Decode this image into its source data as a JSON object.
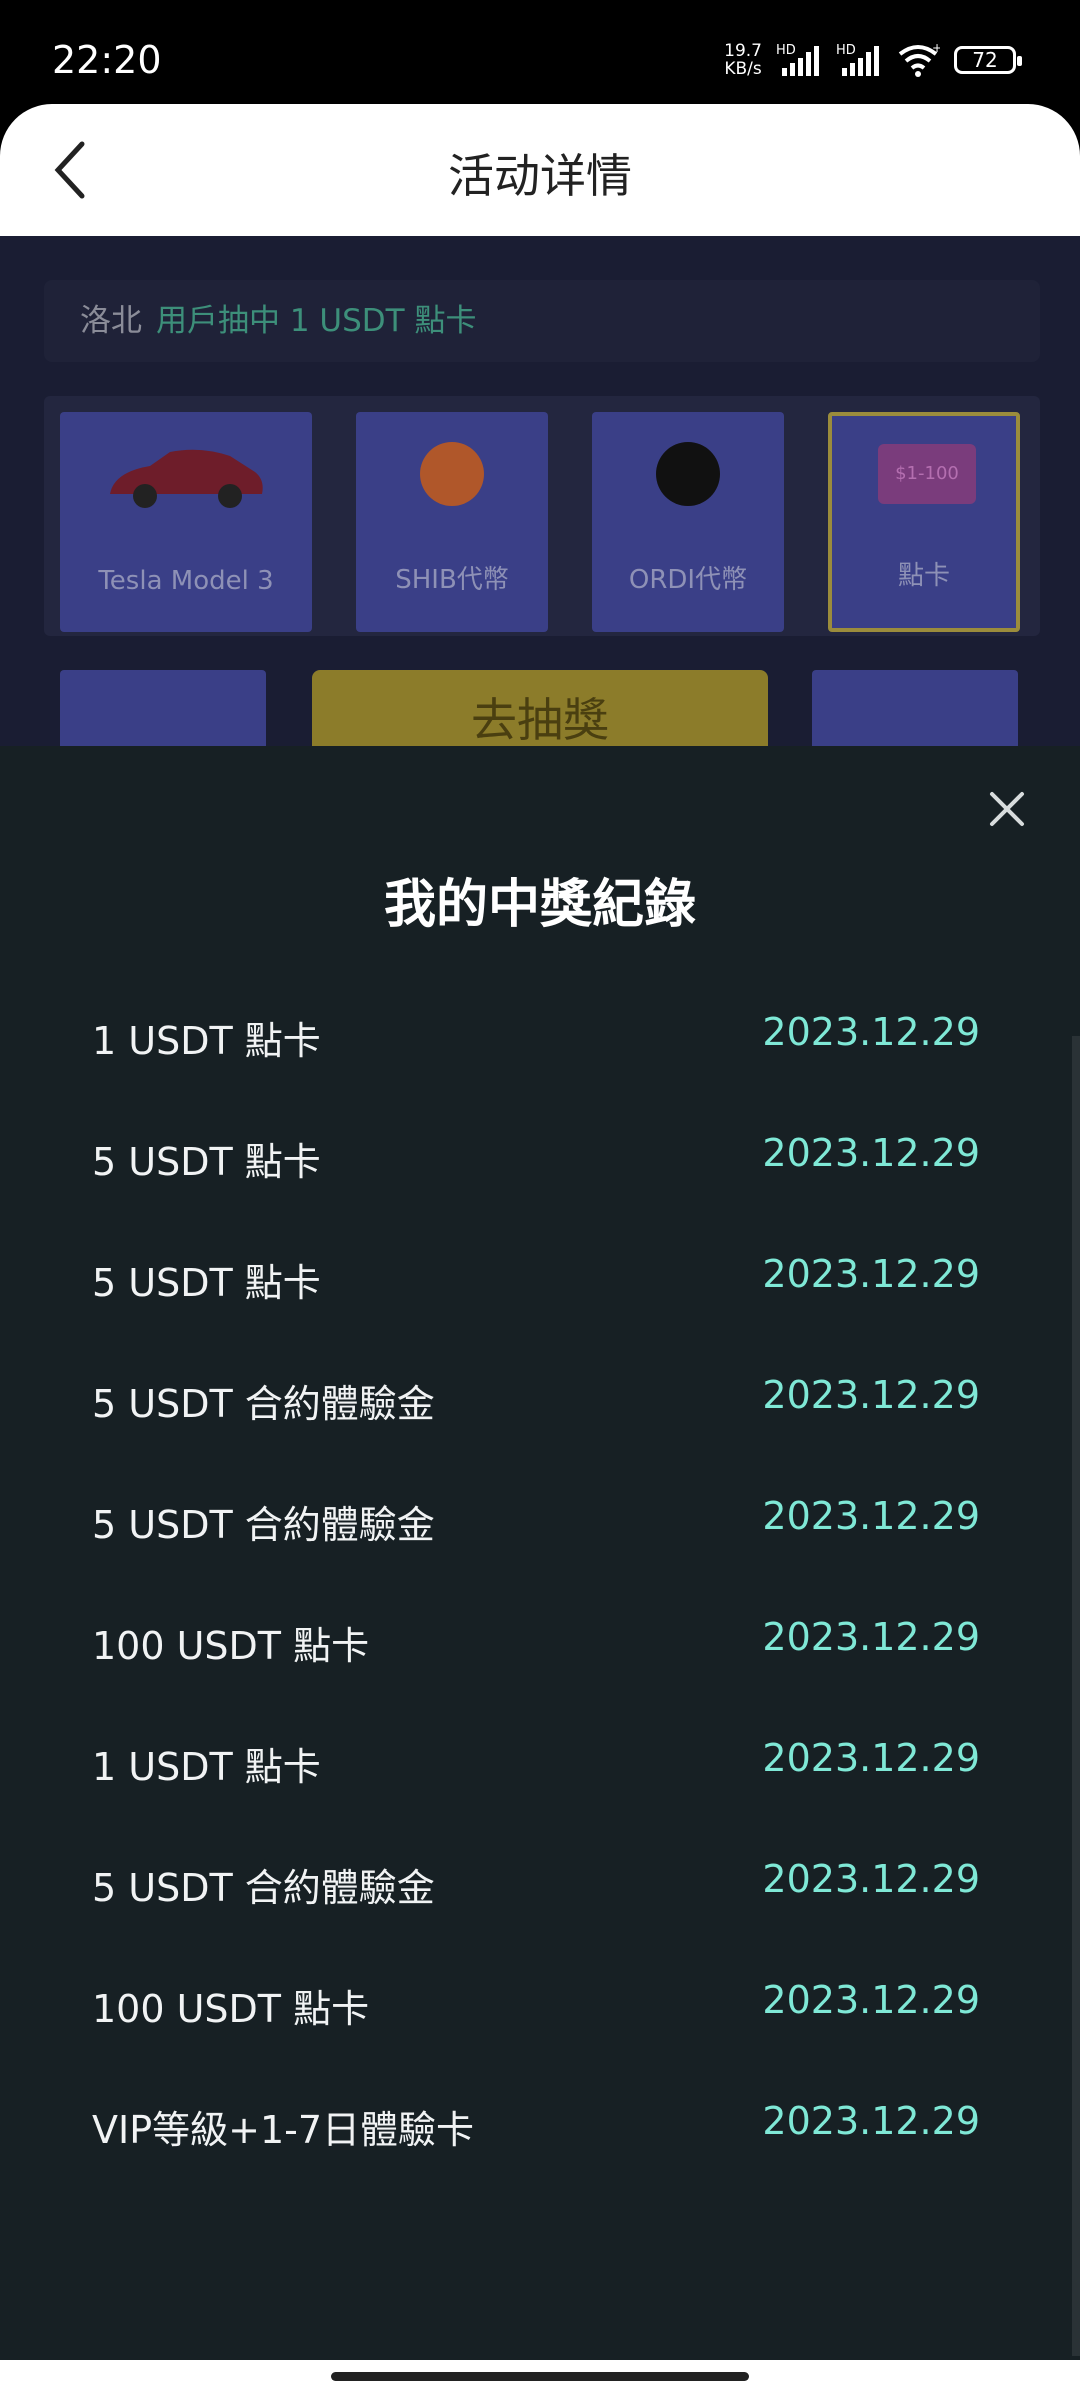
{
  "status_bar": {
    "time": "22:20",
    "net_speed_value": "19.7",
    "net_speed_unit": "KB/s",
    "hd1": "HD",
    "hd2": "HD",
    "battery": "72"
  },
  "header": {
    "title": "活动详情"
  },
  "background_page": {
    "ticker_user": "洛北",
    "ticker_message": "用戶抽中 1 USDT 點卡",
    "prizes": [
      {
        "label": "Tesla Model 3"
      },
      {
        "label": "SHIB代幣"
      },
      {
        "label": "ORDI代幣"
      },
      {
        "label": "點卡",
        "badge": "$1-100"
      }
    ],
    "draw_button": "去抽獎"
  },
  "sheet": {
    "title": "我的中獎紀錄",
    "records": [
      {
        "name": "1 USDT 點卡",
        "date": "2023.12.29"
      },
      {
        "name": "5 USDT 點卡",
        "date": "2023.12.29"
      },
      {
        "name": "5 USDT 點卡",
        "date": "2023.12.29"
      },
      {
        "name": "5 USDT 合約體驗金",
        "date": "2023.12.29"
      },
      {
        "name": "5 USDT 合約體驗金",
        "date": "2023.12.29"
      },
      {
        "name": "100 USDT 點卡",
        "date": "2023.12.29"
      },
      {
        "name": "1 USDT 點卡",
        "date": "2023.12.29"
      },
      {
        "name": "5 USDT 合約體驗金",
        "date": "2023.12.29"
      },
      {
        "name": "100 USDT 點卡",
        "date": "2023.12.29"
      },
      {
        "name": "VIP等級+1-7日體驗卡",
        "date": "2023.12.29"
      }
    ]
  },
  "colors": {
    "accent_date": "#7fe8d6",
    "sheet_bg": "#172024"
  }
}
